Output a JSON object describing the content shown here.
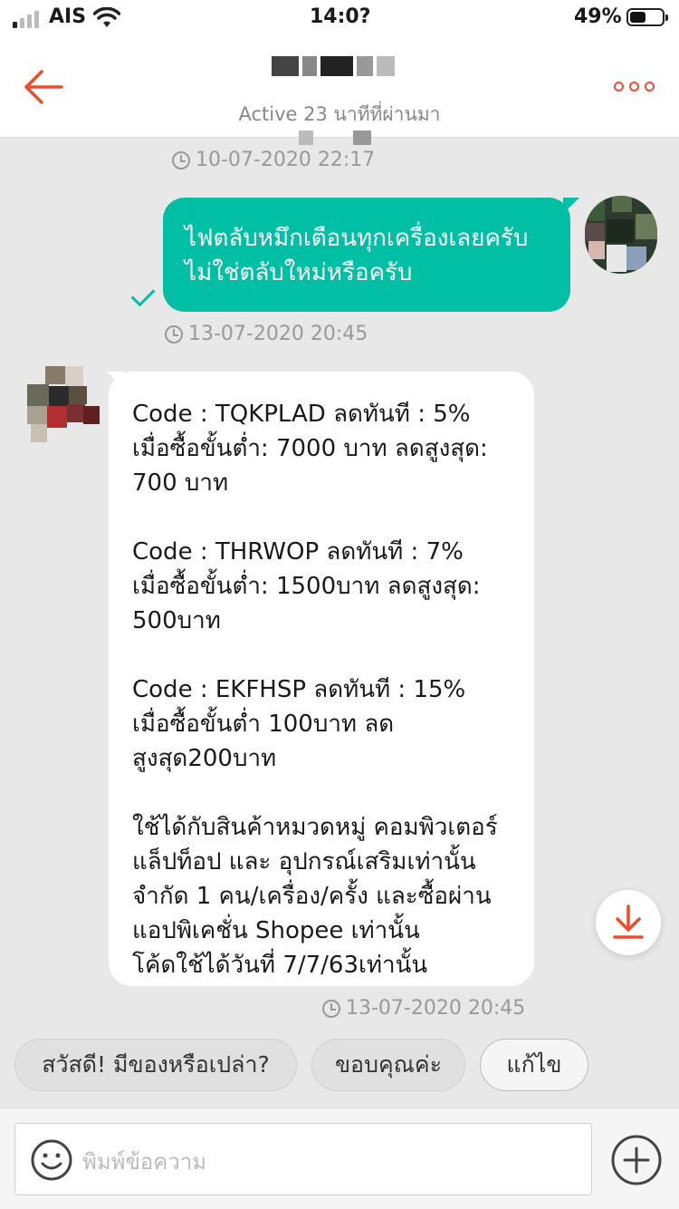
{
  "status_bar": {
    "carrier": "AIS",
    "time": "14:0?",
    "battery": "49%",
    "battery_level": 0.49,
    "signal_bars": 1
  },
  "header": {
    "title": "",
    "subtitle": "Active 23 นาทีที่ผ่านมา",
    "back_icon": "back-arrow-icon",
    "more_icon": "more-dots-icon",
    "accent": "#ee4d2d"
  },
  "messages": [
    {
      "timestamp": "10-07-2020 22:17",
      "direction": "out",
      "text": "ไฟตลับหมึกเตือนทุกเครื่องเลยครับ\nไม่ใช่ตลับใหม่หรือครับ",
      "bubble_color": "#00bfa5",
      "status": "sent"
    },
    {
      "timestamp": "13-07-2020 20:45",
      "direction": "in",
      "text": "Code : TQKPLAD  ลดทันที : 5%\nเมื่อซื้อขั้นต่ำ: 7000 บาท ลดสูงสุด:\n700 บาท\n\nCode : THRWOP  ลดทันที :  7%\nเมื่อซื้อขั้นต่ำ: 1500บาท ลดสูงสุด:\n500บาท\n\nCode : EKFHSP ลดทันที : 15%\nเมื่อซื้อขั้นต่ำ 100บาท ลด\nสูงสุด200บาท\n\nใช้ได้กับสินค้าหมวดหมู่ คอมพิวเตอร์\nแล็ปท็อป และ อุปกรณ์เสริมเท่านั้น\nจำกัด 1 คน/เครื่อง/ครั้ง และซื้อผ่าน\nแอปพิเคชั่น Shopee เท่านั้น\nโค้ดใช้ได้วันที่ 7/7/63เท่านั้น"
    }
  ],
  "last_timestamp": "13-07-2020 20:45",
  "quick_replies": [
    "สวัสดี! มีของหรือเปล่า?",
    "ขอบคุณค่ะ",
    "แก้ไข"
  ],
  "composer": {
    "placeholder": "พิมพ์ข้อความ",
    "emoji_icon": "smiley-icon",
    "plus_icon": "plus-circle-icon"
  }
}
